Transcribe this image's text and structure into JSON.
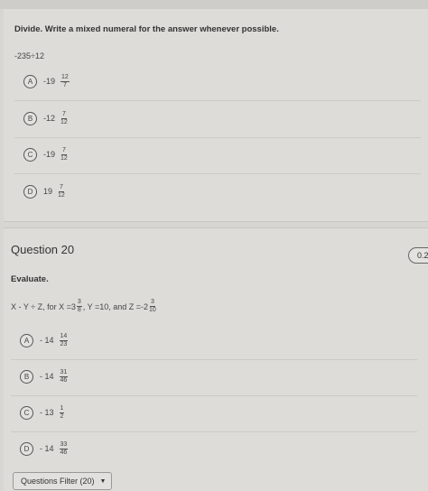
{
  "q19": {
    "instruction": "Divide. Write a mixed numeral for the answer whenever possible.",
    "problem": "-235÷12",
    "options": [
      {
        "letter": "A",
        "whole": "-19",
        "num": "12",
        "den": "7"
      },
      {
        "letter": "B",
        "whole": "-12",
        "num": "7",
        "den": "12"
      },
      {
        "letter": "C",
        "whole": "-19",
        "num": "7",
        "den": "12"
      },
      {
        "letter": "D",
        "whole": "19",
        "num": "7",
        "den": "12"
      }
    ]
  },
  "q20": {
    "title": "Question 20",
    "points": "0.2",
    "instruction": "Evaluate.",
    "expr": {
      "lead": "X - Y ÷ Z, for X =3",
      "x_num": "3",
      "x_den": "8",
      "mid": ", Y =10, and Z =-2",
      "z_num": "3",
      "z_den": "10"
    },
    "options": [
      {
        "letter": "A",
        "whole": "- 14",
        "num": "14",
        "den": "23"
      },
      {
        "letter": "B",
        "whole": "- 14",
        "num": "31",
        "den": "46"
      },
      {
        "letter": "C",
        "whole": "- 13",
        "num": "1",
        "den": "2"
      },
      {
        "letter": "D",
        "whole": "- 14",
        "num": "33",
        "den": "46"
      }
    ]
  },
  "footer": {
    "filter_label": "Questions Filter (20)",
    "caret": "▼"
  }
}
